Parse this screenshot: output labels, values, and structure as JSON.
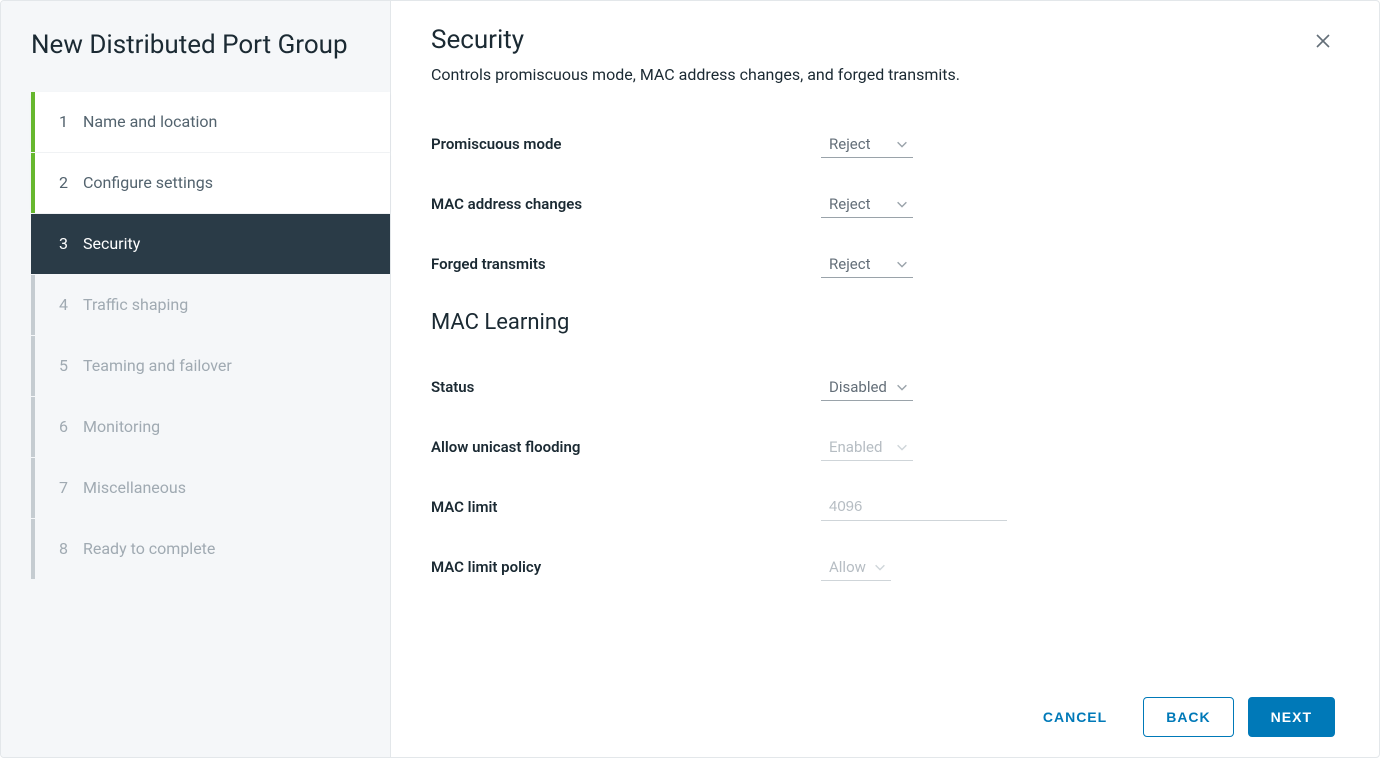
{
  "wizard_title": "New Distributed Port Group",
  "steps": [
    {
      "num": "1",
      "label": "Name and location",
      "state": "completed"
    },
    {
      "num": "2",
      "label": "Configure settings",
      "state": "completed"
    },
    {
      "num": "3",
      "label": "Security",
      "state": "active"
    },
    {
      "num": "4",
      "label": "Traffic shaping",
      "state": "pending"
    },
    {
      "num": "5",
      "label": "Teaming and failover",
      "state": "pending"
    },
    {
      "num": "6",
      "label": "Monitoring",
      "state": "pending"
    },
    {
      "num": "7",
      "label": "Miscellaneous",
      "state": "pending"
    },
    {
      "num": "8",
      "label": "Ready to complete",
      "state": "pending"
    }
  ],
  "page": {
    "title": "Security",
    "subtitle": "Controls promiscuous mode, MAC address changes, and forged transmits."
  },
  "form": {
    "promiscuous_mode": {
      "label": "Promiscuous mode",
      "value": "Reject",
      "disabled": false
    },
    "mac_address_changes": {
      "label": "MAC address changes",
      "value": "Reject",
      "disabled": false
    },
    "forged_transmits": {
      "label": "Forged transmits",
      "value": "Reject",
      "disabled": false
    }
  },
  "mac_learning": {
    "section_title": "MAC Learning",
    "status": {
      "label": "Status",
      "value": "Disabled",
      "disabled": false
    },
    "allow_unicast_flooding": {
      "label": "Allow unicast flooding",
      "value": "Enabled",
      "disabled": true
    },
    "mac_limit": {
      "label": "MAC limit",
      "value": "4096",
      "disabled": true
    },
    "mac_limit_policy": {
      "label": "MAC limit policy",
      "value": "Allow",
      "disabled": true
    }
  },
  "buttons": {
    "cancel": "CANCEL",
    "back": "BACK",
    "next": "NEXT"
  }
}
